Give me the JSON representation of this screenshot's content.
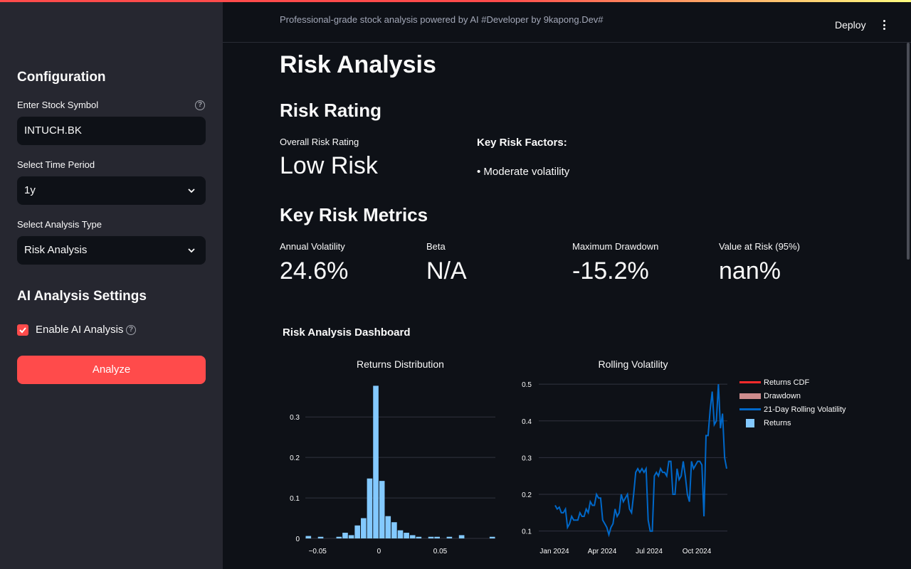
{
  "header": {
    "caption": "Professional-grade stock analysis powered by AI #Developer by 9kapong.Dev#",
    "deploy_label": "Deploy"
  },
  "sidebar": {
    "title": "Configuration",
    "symbol_label": "Enter Stock Symbol",
    "symbol_value": "INTUCH.BK",
    "period_label": "Select Time Period",
    "period_value": "1y",
    "analysis_label": "Select Analysis Type",
    "analysis_value": "Risk Analysis",
    "ai_title": "AI Analysis Settings",
    "ai_checkbox_label": "Enable AI Analysis",
    "ai_checked": true,
    "analyze_button": "Analyze",
    "accent_color": "#ff4b4b"
  },
  "main": {
    "title": "Risk Analysis",
    "risk_rating_heading": "Risk Rating",
    "overall_label": "Overall Risk Rating",
    "overall_value": "Low Risk",
    "factors_title": "Key Risk Factors:",
    "factors": [
      "• Moderate volatility"
    ],
    "metrics_heading": "Key Risk Metrics",
    "metrics": [
      {
        "label": "Annual Volatility",
        "value": "24.6%"
      },
      {
        "label": "Beta",
        "value": "N/A"
      },
      {
        "label": "Maximum Drawdown",
        "value": "-15.2%"
      },
      {
        "label": "Value at Risk (95%)",
        "value": "nan%"
      }
    ],
    "dashboard_title": "Risk Analysis Dashboard"
  },
  "chart_data": [
    {
      "type": "bar",
      "title": "Returns Distribution",
      "xlabel": "",
      "ylabel": "",
      "xlim": [
        -0.06,
        0.095
      ],
      "ylim": [
        0,
        0.39
      ],
      "x_ticks": [
        "−0.05",
        "0",
        "0.05"
      ],
      "x_tick_values": [
        -0.05,
        0,
        0.05
      ],
      "y_ticks": [
        "0",
        "0.1",
        "0.2",
        "0.3"
      ],
      "y_tick_values": [
        0,
        0.1,
        0.2,
        0.3
      ],
      "bin_width": 0.005,
      "bins": [
        {
          "x": -0.0575,
          "v": 0.006
        },
        {
          "x": -0.0475,
          "v": 0.004
        },
        {
          "x": -0.0325,
          "v": 0.004
        },
        {
          "x": -0.0275,
          "v": 0.014
        },
        {
          "x": -0.0225,
          "v": 0.008
        },
        {
          "x": -0.0175,
          "v": 0.032
        },
        {
          "x": -0.0125,
          "v": 0.05
        },
        {
          "x": -0.0075,
          "v": 0.148
        },
        {
          "x": -0.0025,
          "v": 0.377
        },
        {
          "x": 0.0025,
          "v": 0.142
        },
        {
          "x": 0.0075,
          "v": 0.055
        },
        {
          "x": 0.0125,
          "v": 0.04
        },
        {
          "x": 0.0175,
          "v": 0.02
        },
        {
          "x": 0.0225,
          "v": 0.014
        },
        {
          "x": 0.0275,
          "v": 0.008
        },
        {
          "x": 0.0325,
          "v": 0.004
        },
        {
          "x": 0.0425,
          "v": 0.004
        },
        {
          "x": 0.0475,
          "v": 0.004
        },
        {
          "x": 0.0575,
          "v": 0.004
        },
        {
          "x": 0.0675,
          "v": 0.008
        },
        {
          "x": 0.0925,
          "v": 0.004
        }
      ],
      "color": "#83c9ff"
    },
    {
      "type": "line",
      "title": "Rolling Volatility",
      "xlabel": "",
      "ylabel": "",
      "ylim": [
        0.08,
        0.51
      ],
      "x_ticks": [
        "Jan 2024",
        "Apr 2024",
        "Jul 2024",
        "Oct 2024"
      ],
      "y_ticks": [
        "0.1",
        "0.2",
        "0.3",
        "0.4",
        "0.5"
      ],
      "y_tick_values": [
        0.1,
        0.2,
        0.3,
        0.4,
        0.5
      ],
      "series": [
        {
          "name": "21-Day Rolling Volatility",
          "color": "#0068c9",
          "values": [
            0.17,
            0.16,
            0.165,
            0.15,
            0.15,
            0.16,
            0.11,
            0.12,
            0.14,
            0.13,
            0.13,
            0.13,
            0.15,
            0.14,
            0.14,
            0.16,
            0.15,
            0.18,
            0.17,
            0.17,
            0.2,
            0.19,
            0.19,
            0.13,
            0.12,
            0.11,
            0.09,
            0.11,
            0.12,
            0.16,
            0.14,
            0.15,
            0.2,
            0.18,
            0.19,
            0.2,
            0.16,
            0.15,
            0.2,
            0.26,
            0.27,
            0.26,
            0.27,
            0.26,
            0.27,
            0.13,
            0.1,
            0.1,
            0.25,
            0.26,
            0.25,
            0.27,
            0.26,
            0.26,
            0.25,
            0.29,
            0.29,
            0.2,
            0.2,
            0.27,
            0.24,
            0.25,
            0.29,
            0.25,
            0.2,
            0.18,
            0.29,
            0.27,
            0.28,
            0.29,
            0.29,
            0.28,
            0.14,
            0.36,
            0.36,
            0.43,
            0.48,
            0.39,
            0.4,
            0.5,
            0.38,
            0.42,
            0.3,
            0.27
          ]
        }
      ]
    }
  ],
  "legend": [
    {
      "name": "Returns CDF",
      "color": "#ff2b2b",
      "kind": "line"
    },
    {
      "name": "Drawdown",
      "color": "#ffabab",
      "kind": "band"
    },
    {
      "name": "21-Day Rolling Volatility",
      "color": "#0068c9",
      "kind": "line"
    },
    {
      "name": "Returns",
      "color": "#83c9ff",
      "kind": "square"
    }
  ]
}
